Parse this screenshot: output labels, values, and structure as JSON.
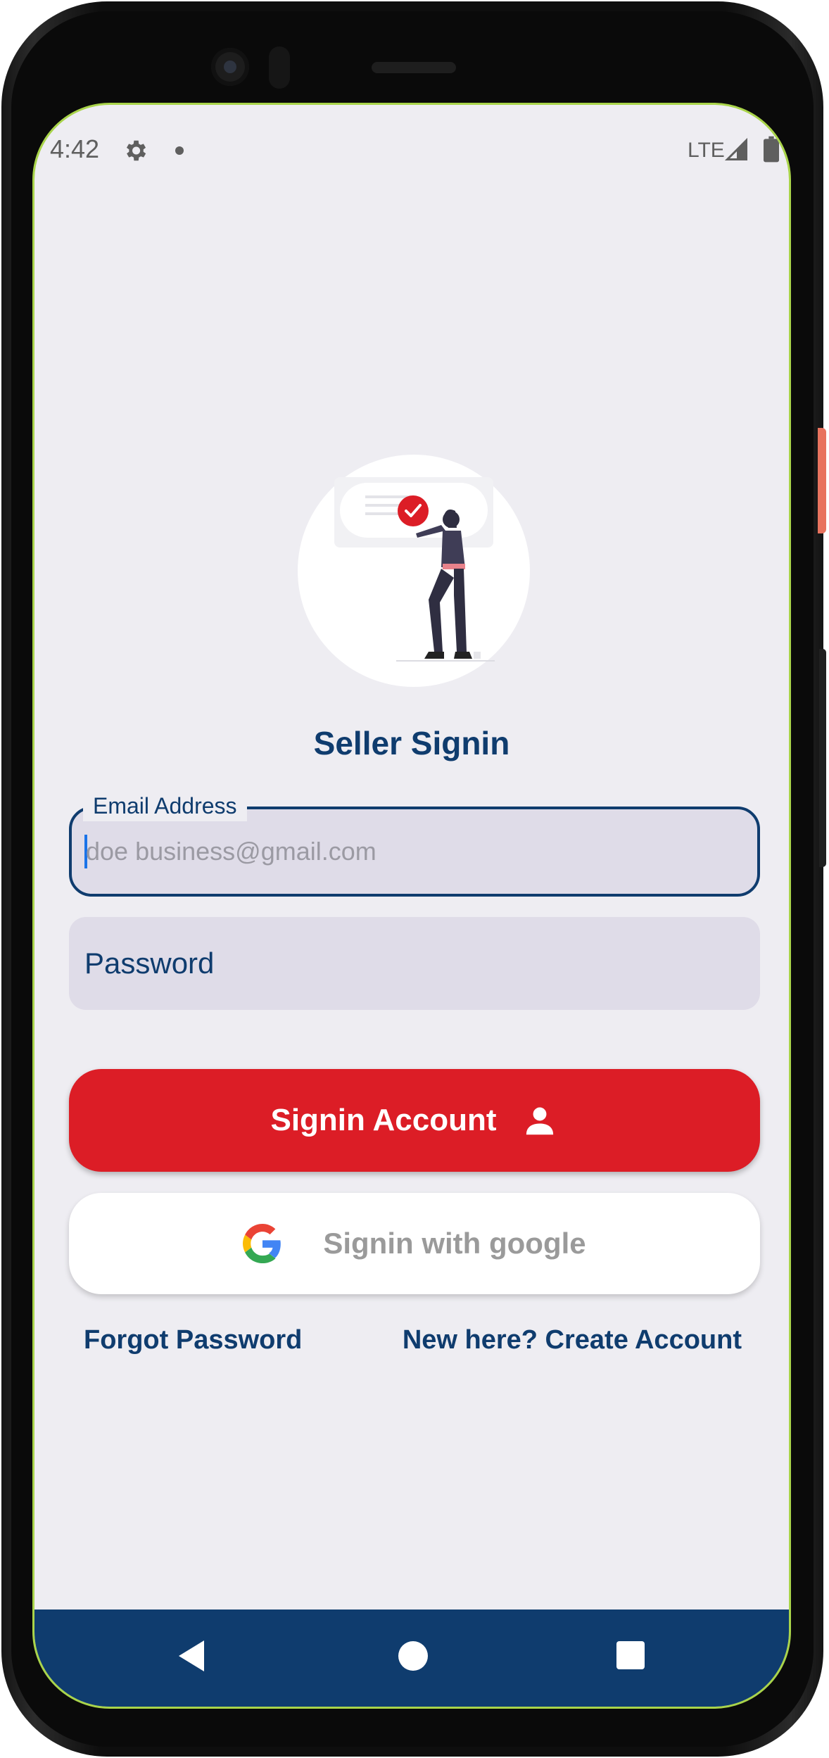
{
  "statusbar": {
    "time": "4:42",
    "network": "LTE",
    "icons": [
      "gear-icon",
      "notification-dot-icon",
      "signal-icon",
      "battery-icon"
    ]
  },
  "screen": {
    "title": "Seller Signin",
    "email": {
      "label": "Email Address",
      "placeholder": "doe business@gmail.com",
      "value": ""
    },
    "password": {
      "placeholder": "Password",
      "value": ""
    },
    "signin_button": {
      "label": "Signin Account",
      "icon": "person-icon"
    },
    "google_button": {
      "label": "Signin with google",
      "icon": "google-icon"
    },
    "links": {
      "forgot": "Forgot Password",
      "create": "New here? Create Account"
    }
  },
  "navbar": {
    "icons": [
      "back-icon",
      "home-icon",
      "recents-icon"
    ]
  },
  "colors": {
    "primary": "#0f3c6e",
    "accent": "#dc1d26",
    "background": "#eeedf2",
    "field": "#dfdce8",
    "screen_border": "#a9d44a"
  }
}
